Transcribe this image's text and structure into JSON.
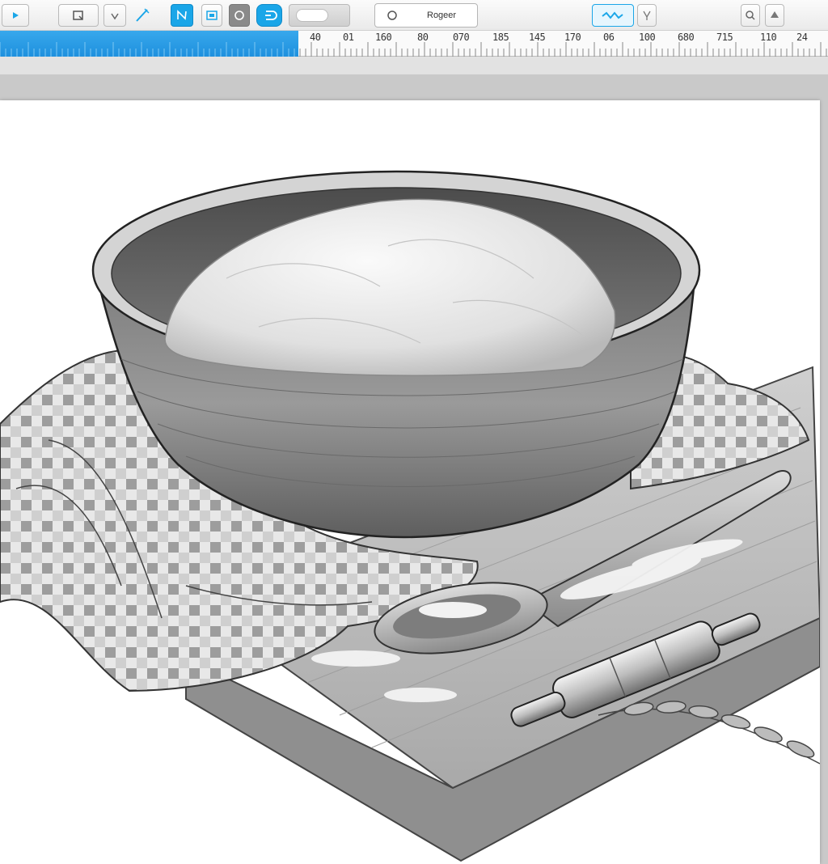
{
  "toolbar": {
    "search_text": "Rogeer",
    "tools": [
      {
        "icon": "play-icon"
      },
      {
        "icon": "select-rect-icon"
      },
      {
        "icon": "check-icon"
      },
      {
        "icon": "pen-icon"
      },
      {
        "icon": "curve-tool-icon"
      },
      {
        "icon": "image-icon"
      },
      {
        "icon": "circle-icon"
      },
      {
        "icon": "loop-icon"
      },
      {
        "icon": "wave-icon"
      },
      {
        "icon": "fork-icon"
      },
      {
        "icon": "zoom-icon"
      },
      {
        "icon": "up-arrow-icon"
      }
    ],
    "colors": {
      "accent": "#1aa6e8",
      "accent_dark": "#0f8ac8"
    }
  },
  "ruler": {
    "progress": 0.36,
    "labels": [
      "40",
      "01",
      "160",
      "80",
      "070",
      "185",
      "145",
      "170",
      "06",
      "100",
      "680",
      "715",
      "110",
      "24"
    ]
  },
  "canvas": {
    "subject": "pencil sketch of dough in a bowl with checkered cloth, wooden spoon with flour, rolling pin and wheat on a board"
  }
}
